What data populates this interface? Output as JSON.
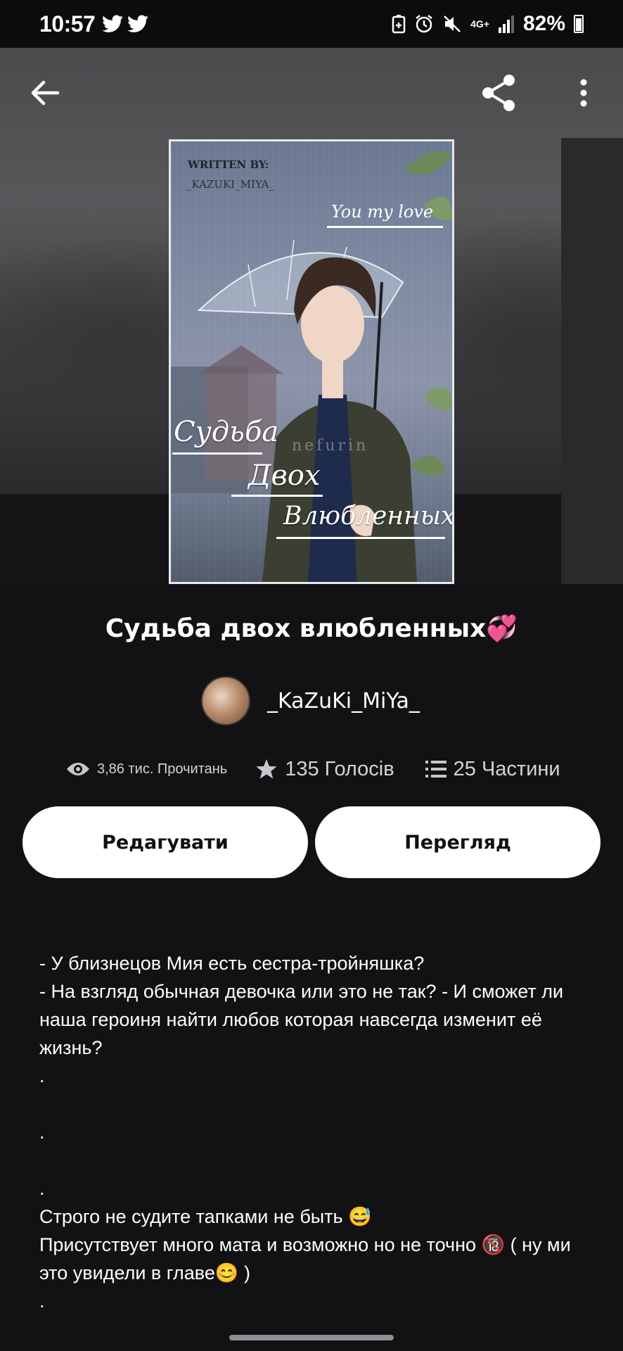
{
  "status_bar": {
    "time": "10:57",
    "left_icons": [
      "twitter-icon",
      "twitter-icon"
    ],
    "right_icons": [
      "battery-saver-icon",
      "alarm-icon",
      "mute-icon",
      "4g-icon",
      "signal-icon"
    ],
    "network": "4G+",
    "battery_percent": "82%"
  },
  "header": {
    "back_icon": "arrow-left-icon",
    "share_icon": "share-icon",
    "more_icon": "more-vertical-icon"
  },
  "cover": {
    "written_by": "WRITTEN BY:",
    "author": "_KAZUKI_MIYA_",
    "tagline": "You my love",
    "title_line1": "Судьба",
    "title_line2": "Двох",
    "title_line3": "Влюбленных",
    "watermark": "nefurin"
  },
  "book": {
    "title": "Судьба двох влюбленных",
    "title_emoji": "💞",
    "author": "_KaZuKi_MiYa_"
  },
  "stats": {
    "reads": "3,86 тис. Прочитань",
    "votes": "135 Голосів",
    "parts": "25 Частини"
  },
  "actions": {
    "edit_label": "Редагувати",
    "view_label": "Перегляд"
  },
  "description": "- У близнецов Мия есть сестра-тройняшка?\n- На взгляд обычная девочка или это не так? - И сможет ли наша героиня найти любов которая навсегда изменит её жизнь?\n.\n\n.\n\n.\nСтрого не судите тапками не быть 😅\nПрисутствует много мата и возможно но не точно 🔞 ( ну ми это увидели в главе😊 )\n."
}
